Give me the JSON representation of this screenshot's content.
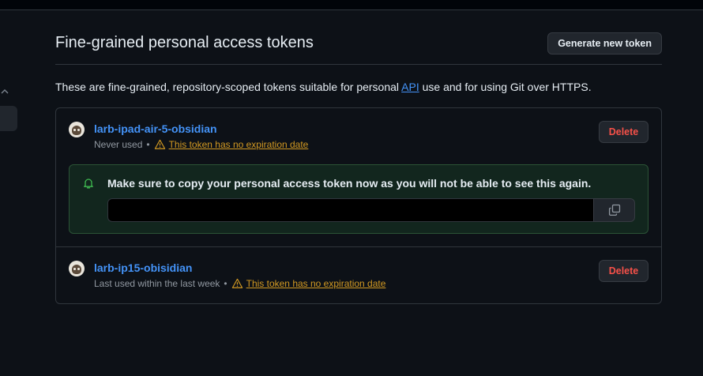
{
  "page": {
    "title": "Fine-grained personal access tokens",
    "generate_button": "Generate new token",
    "description_before": "These are fine-grained, repository-scoped tokens suitable for personal ",
    "description_link": "API",
    "description_after": " use and for using Git over HTTPS."
  },
  "tokens": [
    {
      "name": "larb-ipad-air-5-obsidian",
      "usage": "Never used",
      "separator": "•",
      "warning": "This token has no expiration date",
      "delete_label": "Delete"
    },
    {
      "name": "larb-ip15-obisidian",
      "usage": "Last used within the last week",
      "separator": "•",
      "warning": "This token has no expiration date",
      "delete_label": "Delete"
    }
  ],
  "flash": {
    "message": "Make sure to copy your personal access token now as you will not be able to see this again.",
    "token_value": ""
  },
  "colors": {
    "background": "#0d1117",
    "link": "#4493f8",
    "danger": "#f85149",
    "warning": "#d29922",
    "success_bg": "#12261e"
  }
}
